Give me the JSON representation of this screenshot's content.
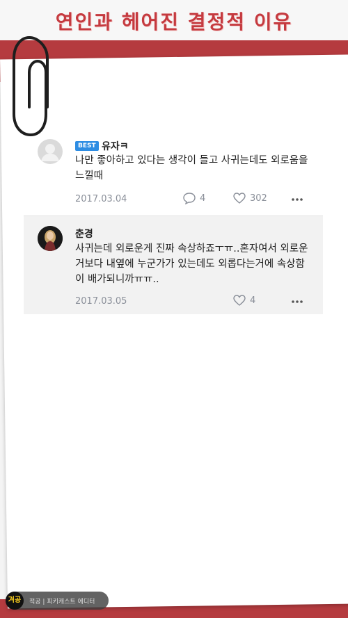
{
  "header": {
    "title": "연인과 헤어진 결정적 이유"
  },
  "comments": [
    {
      "badge": "BEST",
      "username": "유자ㅋ",
      "text": "나만 좋아하고 있다는 생각이 들고 사귀는데도 외로움을 느낄때",
      "date": "2017.03.04",
      "replies": "4",
      "likes": "302"
    },
    {
      "username": "춘경",
      "text": "사귀는데 외로운게 진짜 속상하죠ㅜㅠ..혼자여서 외로운거보다 내옆에 누군가가 있는데도 외롭다는거에 속상함이 배가되니까ㅠㅠ..",
      "date": "2017.03.05",
      "likes": "4"
    }
  ],
  "footer": {
    "logo_text": "겨공",
    "credit": "적공 | 피키캐스트 에디터"
  },
  "icons": {
    "reply": "speech-bubble-icon",
    "like": "heart-icon",
    "more": "more-dots-icon",
    "clip": "paperclip-icon"
  },
  "colors": {
    "accent_red": "#b53b3f",
    "best_blue": "#2e8de3",
    "meta_gray": "#8a8f99"
  }
}
